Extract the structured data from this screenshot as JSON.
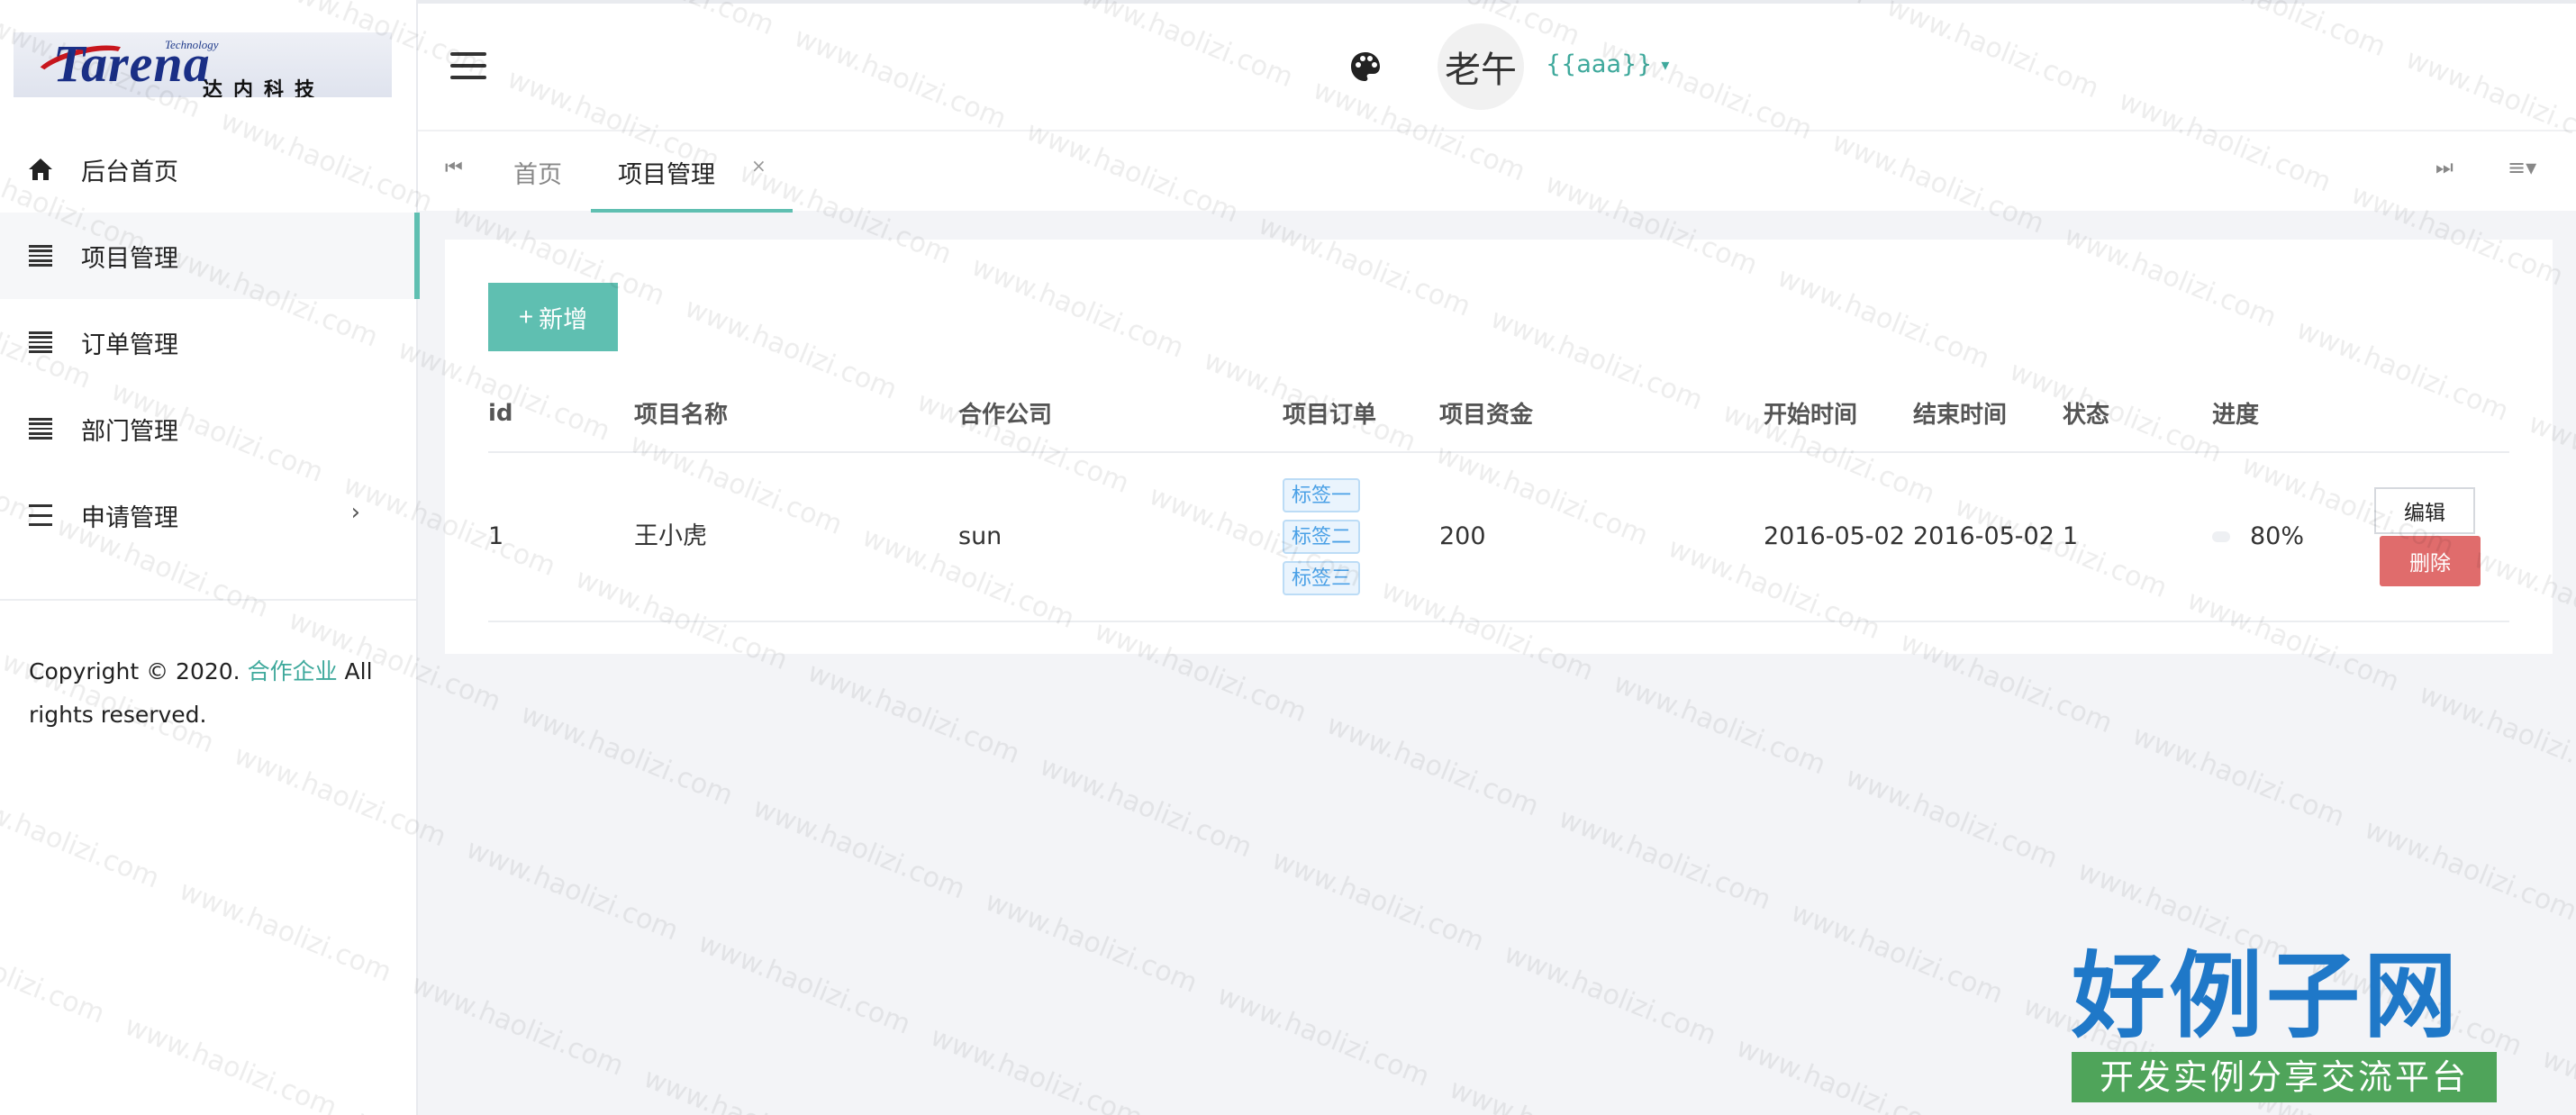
{
  "brand": {
    "logo_word": "Tarena",
    "logo_small": "Technology",
    "logo_cn": "达内科技"
  },
  "sidebar": {
    "items": [
      {
        "label": "后台首页",
        "icon": "home-icon"
      },
      {
        "label": "项目管理",
        "icon": "list-icon",
        "active": true
      },
      {
        "label": "订单管理",
        "icon": "list-icon"
      },
      {
        "label": "部门管理",
        "icon": "list-icon"
      },
      {
        "label": "申请管理",
        "icon": "menu-icon",
        "arrow": "›"
      }
    ],
    "copyright_prefix": "Copyright © 2020.",
    "copyright_link": "合作企业",
    "copyright_suffix": "All rights reserved."
  },
  "header": {
    "avatar_text": "老午",
    "username": "{{aaa}}",
    "username_caret": "▾"
  },
  "tabs": {
    "prev": "⏮",
    "next": "⏭",
    "menu": "≡▾",
    "items": [
      {
        "label": "首页"
      },
      {
        "label": "项目管理",
        "active": true,
        "close": "×"
      }
    ]
  },
  "toolbar": {
    "add_plus": "+",
    "add_label": "新增"
  },
  "table": {
    "columns": [
      "id",
      "项目名称",
      "合作公司",
      "项目订单",
      "项目资金",
      "开始时间",
      "结束时间",
      "状态",
      "进度"
    ],
    "rows": [
      {
        "id": "1",
        "name": "王小虎",
        "company": "sun",
        "tags": [
          "标签一",
          "标签二",
          "标签三"
        ],
        "fund": "200",
        "start": "2016-05-02",
        "end": "2016-05-02",
        "status": "1",
        "progress_text": "80%",
        "progress": 0.8,
        "edit_label": "编辑",
        "delete_label": "删除"
      }
    ]
  },
  "colors": {
    "accent": "#5fbfb1",
    "link": "#3fa99c",
    "danger": "#e06c6c",
    "tag_text": "#4aa0e6",
    "progress": "#3e8ef2"
  },
  "overlay": {
    "watermark_text": "www.haolizi.com",
    "stamp_title": "好例子网",
    "stamp_subtitle": "开发实例分享交流平台"
  }
}
